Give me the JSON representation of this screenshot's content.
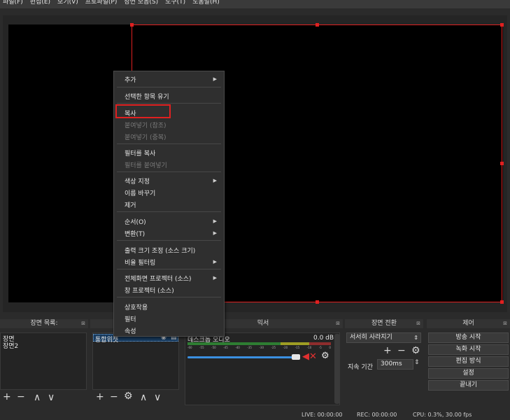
{
  "menubar": {
    "items": [
      "파일(F)",
      "편집(E)",
      "보기(V)",
      "프로파일(P)",
      "장면 모음(S)",
      "도구(T)",
      "도움말(H)"
    ]
  },
  "context_menu": {
    "items": [
      {
        "label": "추가",
        "submenu": true,
        "disabled": false
      },
      {
        "label": "선택한 항목 유기",
        "submenu": false,
        "disabled": false
      },
      {
        "label": "복사",
        "submenu": false,
        "disabled": false,
        "highlighted": true
      },
      {
        "label": "붙여넣기 (참조)",
        "submenu": false,
        "disabled": true
      },
      {
        "label": "붙여넣기 (중복)",
        "submenu": false,
        "disabled": true
      },
      {
        "label": "필터를 복사",
        "submenu": false,
        "disabled": false
      },
      {
        "label": "필터를 붙여넣기",
        "submenu": false,
        "disabled": true
      },
      {
        "label": "색상 지정",
        "submenu": true,
        "disabled": false
      },
      {
        "label": "이름 바꾸기",
        "submenu": false,
        "disabled": false
      },
      {
        "label": "제거",
        "submenu": false,
        "disabled": false
      },
      {
        "label": "순서(O)",
        "submenu": true,
        "disabled": false
      },
      {
        "label": "변환(T)",
        "submenu": true,
        "disabled": false
      },
      {
        "label": "출력 크기 조정 (소스 크기)",
        "submenu": false,
        "disabled": false
      },
      {
        "label": "비율 필터링",
        "submenu": true,
        "disabled": false
      },
      {
        "label": "전체화면 프로젝터 (소스)",
        "submenu": true,
        "disabled": false
      },
      {
        "label": "창 프로젝터 (소스)",
        "submenu": false,
        "disabled": false
      },
      {
        "label": "상호작용",
        "submenu": false,
        "disabled": false
      },
      {
        "label": "필터",
        "submenu": false,
        "disabled": false
      },
      {
        "label": "속성",
        "submenu": false,
        "disabled": false
      }
    ]
  },
  "scenes": {
    "title": "장면 목록:",
    "items": [
      "장면",
      "장면2"
    ]
  },
  "sources": {
    "items": [
      "통합위젯"
    ]
  },
  "mixer": {
    "title": "믹서",
    "track_label": "데스크톱 오디오",
    "db": "0.0 dB",
    "ticks": [
      "-60",
      "-55",
      "-50",
      "-45",
      "-40",
      "-35",
      "-30",
      "-25",
      "-20",
      "-15",
      "-10",
      "-5",
      "0"
    ]
  },
  "transitions": {
    "title": "장면 전환",
    "selected": "서서히 사라지기",
    "duration_label": "지속 기간",
    "duration_value": "300ms"
  },
  "controls": {
    "title": "제어",
    "buttons": [
      "방송 시작",
      "녹화 시작",
      "편집 방식",
      "설정",
      "끝내기"
    ]
  },
  "status": {
    "live": "LIVE: 00:00:00",
    "rec": "REC: 00:00:00",
    "cpu": "CPU: 0.3%, 30.00 fps"
  },
  "colors": {
    "selection": "#e02020",
    "accent_blue": "#3a8fe0",
    "mute_red": "#e03030"
  }
}
